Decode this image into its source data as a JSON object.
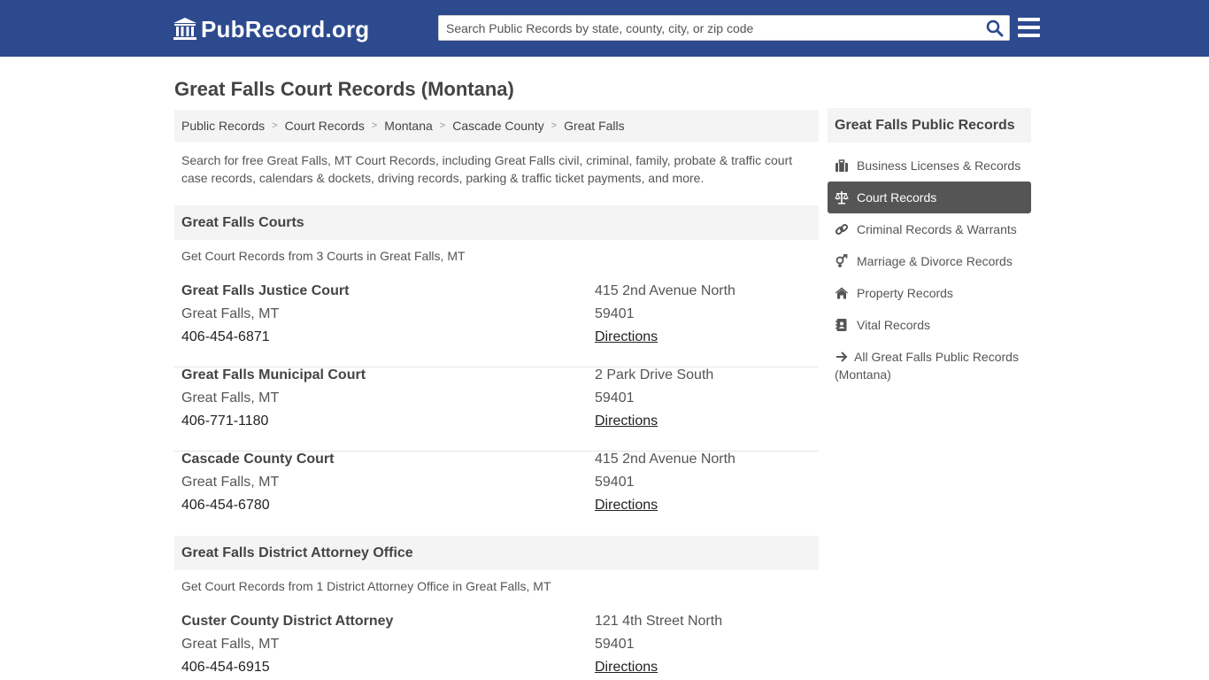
{
  "header": {
    "logo_text": "PubRecord.org",
    "search_placeholder": "Search Public Records by state, county, city, or zip code",
    "bg_color": "#2d4a8f"
  },
  "page": {
    "title": "Great Falls Court Records (Montana)",
    "intro": "Search for free Great Falls, MT Court Records, including Great Falls civil, criminal, family, probate & traffic court case records, calendars & dockets, driving records, parking & traffic ticket payments, and more."
  },
  "breadcrumb": [
    "Public Records",
    "Court Records",
    "Montana",
    "Cascade County",
    "Great Falls"
  ],
  "courts_section": {
    "heading": "Great Falls Courts",
    "subtitle": "Get Court Records from 3 Courts in Great Falls, MT",
    "items": [
      {
        "name": "Great Falls Justice Court",
        "city": "Great Falls, MT",
        "phone": "406-454-6871",
        "address": "415 2nd Avenue North",
        "zip": "59401",
        "directions": "Directions"
      },
      {
        "name": "Great Falls Municipal Court",
        "city": "Great Falls, MT",
        "phone": "406-771-1180",
        "address": "2 Park Drive South",
        "zip": "59401",
        "directions": "Directions"
      },
      {
        "name": "Cascade County Court",
        "city": "Great Falls, MT",
        "phone": "406-454-6780",
        "address": "415 2nd Avenue North",
        "zip": "59401",
        "directions": "Directions"
      }
    ]
  },
  "da_section": {
    "heading": "Great Falls District Attorney Office",
    "subtitle": "Get Court Records from 1 District Attorney Office in Great Falls, MT",
    "items": [
      {
        "name": "Custer County District Attorney",
        "city": "Great Falls, MT",
        "phone": "406-454-6915",
        "address": "121 4th Street North",
        "zip": "59401",
        "directions": "Directions"
      }
    ]
  },
  "sidebar": {
    "heading": "Great Falls Public Records",
    "items": [
      {
        "label": "Business Licenses & Records",
        "icon": "briefcase-icon"
      },
      {
        "label": "Court Records",
        "icon": "scales-icon",
        "active": true
      },
      {
        "label": "Criminal Records & Warrants",
        "icon": "link-icon"
      },
      {
        "label": "Marriage & Divorce Records",
        "icon": "gender-icon"
      },
      {
        "label": "Property Records",
        "icon": "home-icon"
      },
      {
        "label": "Vital Records",
        "icon": "address-book-icon"
      }
    ],
    "all_link": "All Great Falls Public Records (Montana)",
    "active_color": "#555555"
  }
}
